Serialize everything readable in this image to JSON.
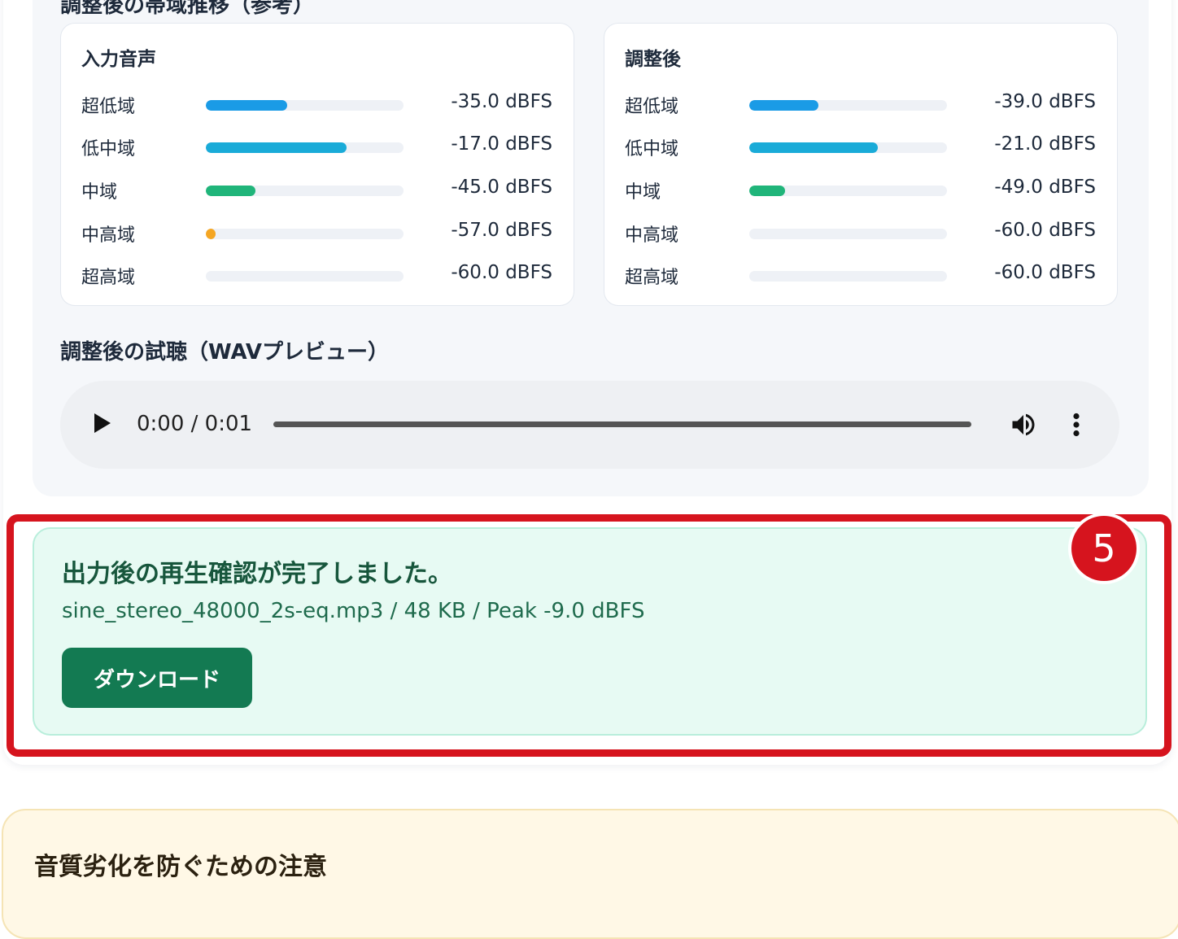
{
  "section_heading_cut": "調整後の帯域推移（参考）",
  "input_card": {
    "title": "入力音声",
    "bands": [
      {
        "label": "超低域",
        "value": "-35.0 dBFS",
        "level": 0.41,
        "color": "#1a9be6"
      },
      {
        "label": "低中域",
        "value": "-17.0 dBFS",
        "level": 0.71,
        "color": "#1aabd8"
      },
      {
        "label": "中域",
        "value": "-45.0 dBFS",
        "level": 0.25,
        "color": "#20b57a"
      },
      {
        "label": "中高域",
        "value": "-57.0 dBFS",
        "level": 0.05,
        "color": "#f5a623"
      },
      {
        "label": "超高域",
        "value": "-60.0 dBFS",
        "level": 0.0,
        "color": "#cccccc"
      }
    ]
  },
  "after_card": {
    "title": "調整後",
    "bands": [
      {
        "label": "超低域",
        "value": "-39.0 dBFS",
        "level": 0.35,
        "color": "#1a9be6"
      },
      {
        "label": "低中域",
        "value": "-21.0 dBFS",
        "level": 0.65,
        "color": "#1aabd8"
      },
      {
        "label": "中域",
        "value": "-49.0 dBFS",
        "level": 0.18,
        "color": "#20b57a"
      },
      {
        "label": "中高域",
        "value": "-60.0 dBFS",
        "level": 0.0,
        "color": "#cccccc"
      },
      {
        "label": "超高域",
        "value": "-60.0 dBFS",
        "level": 0.0,
        "color": "#cccccc"
      }
    ]
  },
  "preview": {
    "title": "調整後の試聴（WAVプレビュー）",
    "time": "0:00 / 0:01",
    "progress": 0.0
  },
  "result": {
    "title": "出力後の再生確認が完了しました。",
    "details": "sine_stereo_48000_2s-eq.mp3 / 48 KB / Peak -9.0 dBFS",
    "download_label": "ダウンロード"
  },
  "annotation": {
    "step_number": "5",
    "color": "#d6141e"
  },
  "warning": {
    "title": "音質劣化を防ぐための注意"
  }
}
